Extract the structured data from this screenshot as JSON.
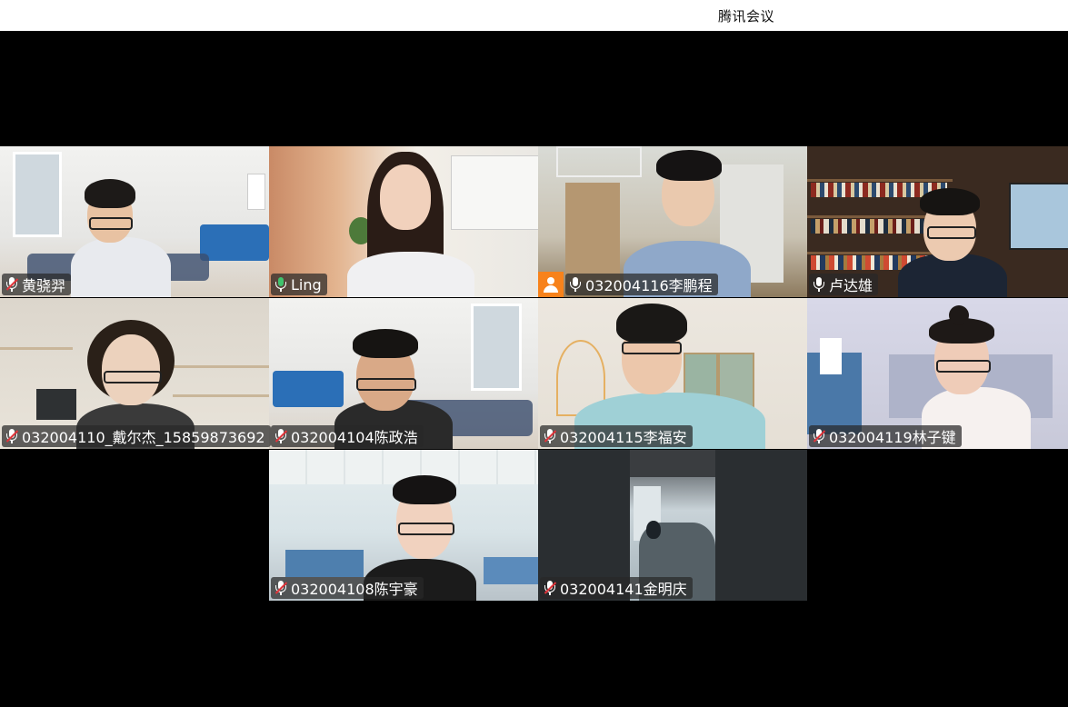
{
  "window": {
    "title": "腾讯会议"
  },
  "participants": [
    {
      "name": "黄骁羿",
      "mic": "muted"
    },
    {
      "name": "Ling",
      "mic": "on",
      "speaking": true
    },
    {
      "name": "032004116李鹏程",
      "mic": "on",
      "avatar_badge": "user-icon"
    },
    {
      "name": "卢达雄",
      "mic": "on"
    },
    {
      "name": "032004110_戴尔杰_15859873692",
      "mic": "muted"
    },
    {
      "name": "032004104陈政浩",
      "mic": "muted"
    },
    {
      "name": "032004115李福安",
      "mic": "muted"
    },
    {
      "name": "032004119林子键",
      "mic": "muted"
    },
    {
      "name": "032004108陈宇豪",
      "mic": "muted"
    },
    {
      "name": "032004141金明庆",
      "mic": "muted"
    }
  ],
  "colors": {
    "speaking_border": "#3fc36d",
    "muted_icon": "#e0353b",
    "avatar_badge": "#f7821b"
  }
}
